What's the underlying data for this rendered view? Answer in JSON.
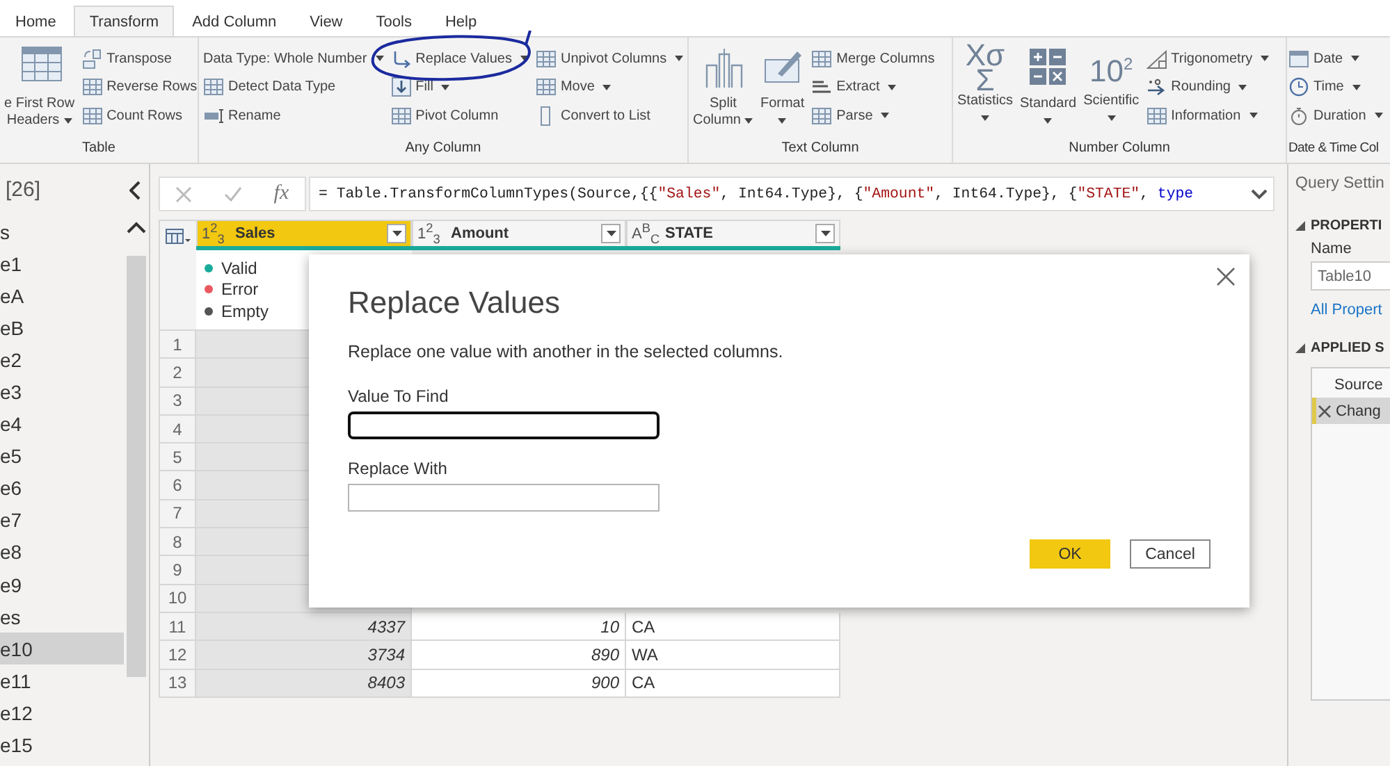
{
  "tabs": [
    {
      "label": "Home",
      "selected": false
    },
    {
      "label": "Transform",
      "selected": true
    },
    {
      "label": "Add Column",
      "selected": false
    },
    {
      "label": "View",
      "selected": false
    },
    {
      "label": "Tools",
      "selected": false
    },
    {
      "label": "Help",
      "selected": false
    }
  ],
  "ribbon": {
    "groups": [
      {
        "label": "Table",
        "large": [
          {
            "lines": [
              "e First Row",
              "Headers"
            ],
            "dropdown": true
          }
        ],
        "columns": [
          [
            {
              "label": "Transpose",
              "dropdown": false
            },
            {
              "label": "Reverse Rows",
              "dropdown": false
            },
            {
              "label": "Count Rows",
              "dropdown": false
            }
          ]
        ]
      },
      {
        "label": "Any Column",
        "columns": [
          [
            {
              "label": "Data Type: Whole Number",
              "dropdown": true
            },
            {
              "label": "Detect Data Type",
              "dropdown": false
            },
            {
              "label": "Rename",
              "dropdown": false
            }
          ],
          [
            {
              "label": "Replace Values",
              "dropdown": true
            },
            {
              "label": "Fill",
              "dropdown": true
            },
            {
              "label": "Pivot Column",
              "dropdown": false
            }
          ],
          [
            {
              "label": "Unpivot Columns",
              "dropdown": true
            },
            {
              "label": "Move",
              "dropdown": true
            },
            {
              "label": "Convert to List",
              "dropdown": false
            }
          ]
        ]
      },
      {
        "label": "Text Column",
        "large": [
          {
            "lines": [
              "Split",
              "Column"
            ],
            "dropdown": true
          },
          {
            "lines": [
              "Format"
            ],
            "dropdown": true
          }
        ],
        "columns": [
          [
            {
              "label": "Merge Columns",
              "dropdown": false
            },
            {
              "label": "Extract",
              "dropdown": true
            },
            {
              "label": "Parse",
              "dropdown": true
            }
          ]
        ]
      },
      {
        "label": "Number Column",
        "large": [
          {
            "lines": [
              "Statistics"
            ],
            "dropdown": true,
            "glyph": [
              "Xσ",
              "Σ"
            ]
          },
          {
            "lines": [
              "Standard"
            ],
            "dropdown": true
          },
          {
            "lines": [
              "Scientific"
            ],
            "dropdown": true,
            "glyph": [
              "10$^{2}$"
            ]
          }
        ],
        "columns": [
          [
            {
              "label": "Trigonometry",
              "dropdown": true
            },
            {
              "label": "Rounding",
              "dropdown": true
            },
            {
              "label": "Information",
              "dropdown": true
            }
          ]
        ]
      },
      {
        "label": "Date & Time Col",
        "columns": [
          [
            {
              "label": "Date",
              "dropdown": true
            },
            {
              "label": "Time",
              "dropdown": true
            },
            {
              "label": "Duration",
              "dropdown": true
            }
          ]
        ]
      }
    ]
  },
  "queries": {
    "count": "[26]",
    "items": [
      {
        "label": "s",
        "selected": false
      },
      {
        "label": "e1",
        "selected": false
      },
      {
        "label": "eA",
        "selected": false
      },
      {
        "label": "eB",
        "selected": false
      },
      {
        "label": "e2",
        "selected": false
      },
      {
        "label": "e3",
        "selected": false
      },
      {
        "label": "e4",
        "selected": false
      },
      {
        "label": "e5",
        "selected": false
      },
      {
        "label": "e6",
        "selected": false
      },
      {
        "label": "e7",
        "selected": false
      },
      {
        "label": "e8",
        "selected": false
      },
      {
        "label": "e9",
        "selected": false
      },
      {
        "label": "es",
        "selected": false
      },
      {
        "label": "e10",
        "selected": true
      },
      {
        "label": "e11",
        "selected": false
      },
      {
        "label": "e12",
        "selected": false
      },
      {
        "label": "e15",
        "selected": false
      }
    ]
  },
  "formula": {
    "function_button": "fx",
    "tokens": [
      {
        "kind": "plain",
        "text": "= Table.TransformColumnTypes(Source,{{"
      },
      {
        "kind": "string",
        "text": "\"Sales\""
      },
      {
        "kind": "plain",
        "text": ", Int64.Type}, {"
      },
      {
        "kind": "string",
        "text": "\"Amount\""
      },
      {
        "kind": "plain",
        "text": ", Int64.Type}, {"
      },
      {
        "kind": "string",
        "text": "\"STATE\""
      },
      {
        "kind": "plain",
        "text": ", "
      },
      {
        "kind": "keyword",
        "text": "type"
      }
    ]
  },
  "grid": {
    "columns": [
      {
        "name": "Sales",
        "type_icon": "1$^{2}$$_{3}$",
        "kind": "number",
        "selected": true
      },
      {
        "name": "Amount",
        "type_icon": "1$^{2}$$_{3}$",
        "kind": "number",
        "selected": false
      },
      {
        "name": "STATE",
        "type_icon": "A$^{B}$$_{C}$",
        "kind": "text",
        "selected": false
      }
    ],
    "quality": [
      {
        "label": "Valid",
        "color": "#1aab9b"
      },
      {
        "label": "Error",
        "color": "#e8595f"
      },
      {
        "label": "Empty",
        "color": "#555555"
      }
    ],
    "rows": [
      {
        "number": "1"
      },
      {
        "number": "2"
      },
      {
        "number": "3"
      },
      {
        "number": "4"
      },
      {
        "number": "5"
      },
      {
        "number": "6"
      },
      {
        "number": "7"
      },
      {
        "number": "8"
      },
      {
        "number": "9"
      },
      {
        "number": "10"
      },
      {
        "number": "11",
        "cells": [
          "4337",
          "10",
          "CA"
        ]
      },
      {
        "number": "12",
        "cells": [
          "3734",
          "890",
          "WA"
        ]
      },
      {
        "number": "13",
        "cells": [
          "8403",
          "900",
          "CA"
        ]
      }
    ]
  },
  "dialog": {
    "title": "Replace Values",
    "description": "Replace one value with another in the selected columns.",
    "fields": [
      {
        "label": "Value To Find",
        "focused": true
      },
      {
        "label": "Replace With",
        "focused": false
      }
    ],
    "buttons": [
      {
        "label": "OK",
        "kind": "primary"
      },
      {
        "label": "Cancel",
        "kind": "secondary"
      }
    ]
  },
  "settings": {
    "title": "Query Settin",
    "properties": {
      "heading": "PROPERTI",
      "name_label": "Name",
      "name_value": "Table10",
      "link": "All Propert"
    },
    "steps": {
      "heading": "APPLIED S",
      "items": [
        {
          "label": "Source",
          "selected": false
        },
        {
          "label": "Chang",
          "selected": true
        }
      ]
    }
  }
}
